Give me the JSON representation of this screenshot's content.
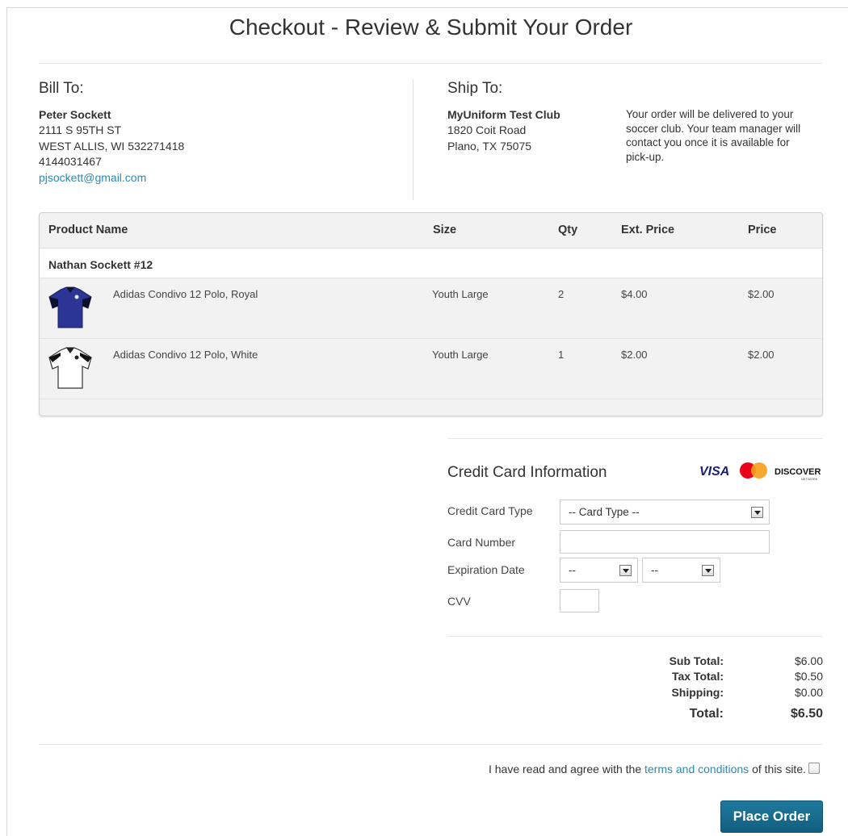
{
  "page_title": "Checkout - Review & Submit Your Order",
  "bill_to": {
    "heading": "Bill To:",
    "name": "Peter Sockett",
    "street": "2111 S 95TH ST",
    "city_line": "WEST ALLIS, WI 532271418",
    "phone": "4144031467",
    "email": "pjsockett@gmail.com"
  },
  "ship_to": {
    "heading": "Ship To:",
    "name": "MyUniform Test Club",
    "street": "1820 Coit Road",
    "city_line": "Plano, TX 75075",
    "note": "Your order will be delivered to your soccer club. Your team manager will contact you once it is available for pick-up."
  },
  "table": {
    "headers": [
      "Product Name",
      "Size",
      "Qty",
      "Ext. Price",
      "Price"
    ],
    "group_label": "Nathan Sockett #12",
    "rows": [
      {
        "name": "Adidas Condivo 12 Polo, Royal",
        "size": "Youth Large",
        "qty": "2",
        "ext_price": "$4.00",
        "price": "$2.00",
        "thumb": "royal-polo-icon"
      },
      {
        "name": "Adidas Condivo 12 Polo, White",
        "size": "Youth Large",
        "qty": "1",
        "ext_price": "$2.00",
        "price": "$2.00",
        "thumb": "white-polo-icon"
      }
    ]
  },
  "credit_card": {
    "title": "Credit Card Information",
    "logos": [
      "VISA",
      "MasterCard",
      "DISCOVER",
      "NETWORK"
    ],
    "type_label": "Credit Card Type",
    "type_value": "-- Card Type --",
    "number_label": "Card Number",
    "number_value": "",
    "exp_label": "Expiration Date",
    "exp_month_value": "--",
    "exp_year_value": "--",
    "cvv_label": "CVV",
    "cvv_value": ""
  },
  "totals": {
    "sub_total_label": "Sub Total:",
    "sub_total": "$6.00",
    "tax_label": "Tax Total:",
    "tax": "$0.50",
    "shipping_label": "Shipping:",
    "shipping": "$0.00",
    "total_label": "Total:",
    "total": "$6.50"
  },
  "terms": {
    "prefix": "I have read and agree with the",
    "link": "terms and conditions",
    "suffix": "of this site.",
    "checked": false
  },
  "submit_label": "Place Order",
  "colors": {
    "link": "#2a8ab5",
    "button": "#1a6f93",
    "visa": "#1a1f71",
    "mc_red": "#eb001b",
    "mc_orange": "#f79e1b"
  }
}
